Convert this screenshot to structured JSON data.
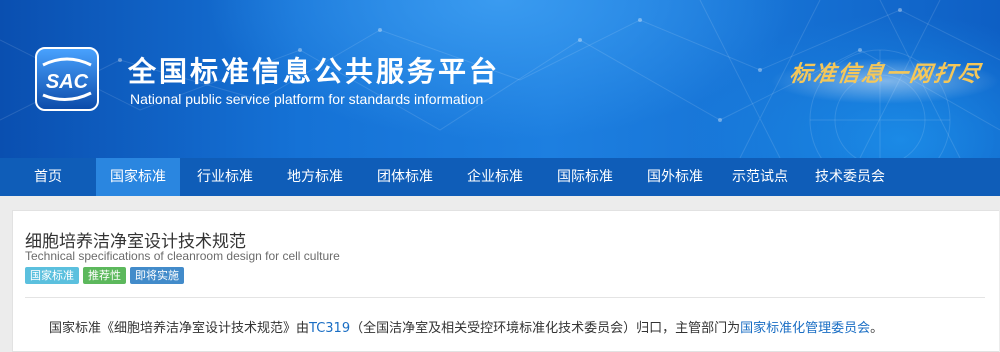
{
  "header": {
    "logo_text": "SAC",
    "title_cn": "全国标准信息公共服务平台",
    "title_en": "National public service platform  for standards information",
    "slogan": "标准信息一网打尽"
  },
  "nav": {
    "items": [
      {
        "label": "首页",
        "active": false
      },
      {
        "label": "国家标准",
        "active": true
      },
      {
        "label": "行业标准",
        "active": false
      },
      {
        "label": "地方标准",
        "active": false
      },
      {
        "label": "团体标准",
        "active": false
      },
      {
        "label": "企业标准",
        "active": false
      },
      {
        "label": "国际标准",
        "active": false
      },
      {
        "label": "国外标准",
        "active": false
      },
      {
        "label": "示范试点",
        "active": false
      },
      {
        "label": "技术委员会",
        "active": false
      }
    ]
  },
  "standard": {
    "title_cn": "细胞培养洁净室设计技术规范",
    "title_en": "Technical specifications of cleanroom design for cell culture",
    "badges": [
      {
        "label": "国家标准",
        "color": "#5bc0de"
      },
      {
        "label": "推荐性",
        "color": "#5cb85c"
      },
      {
        "label": "即将实施",
        "color": "#428bca"
      }
    ],
    "description": {
      "prefix": "国家标准《细胞培养洁净室设计技术规范》由",
      "tc_link": "TC319",
      "middle": "（全国洁净室及相关受控环境标准化技术委员会）归口，主管部门为",
      "dept_link": "国家标准化管理委员会",
      "suffix": "。"
    }
  },
  "colors": {
    "banner_blue": "#1572d6",
    "nav_blue": "#0f5db8",
    "nav_active": "#2a86e0",
    "link": "#1a6ec4",
    "slogan_gold": "#f4c75a"
  }
}
